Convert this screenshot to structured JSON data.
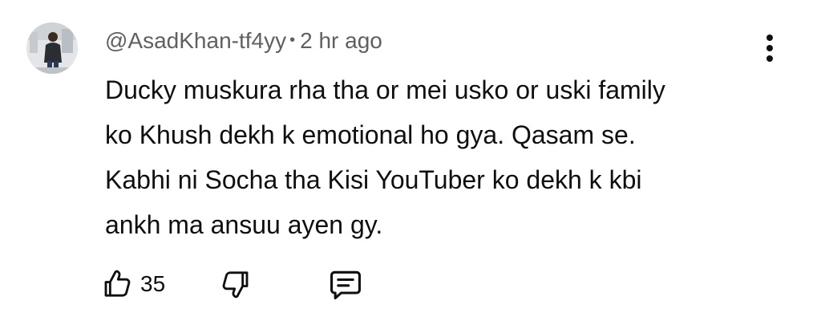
{
  "comment": {
    "author": "@AsadKhan-tf4yy",
    "separator": "•",
    "time": "2 hr ago",
    "lines": [
      "Ducky muskura rha tha or mei usko or uski family",
      "ko Khush dekh k emotional ho gya. Qasam se.",
      "Kabhi ni Socha tha Kisi YouTuber ko dekh k kbi",
      "ankh ma ansuu ayen gy."
    ],
    "like_count": "35"
  },
  "icons": {
    "avatar": "user-avatar-photo",
    "more": "more-vertical-icon",
    "like": "thumb-up-icon",
    "dislike": "thumb-down-icon",
    "reply": "comment-reply-icon"
  }
}
